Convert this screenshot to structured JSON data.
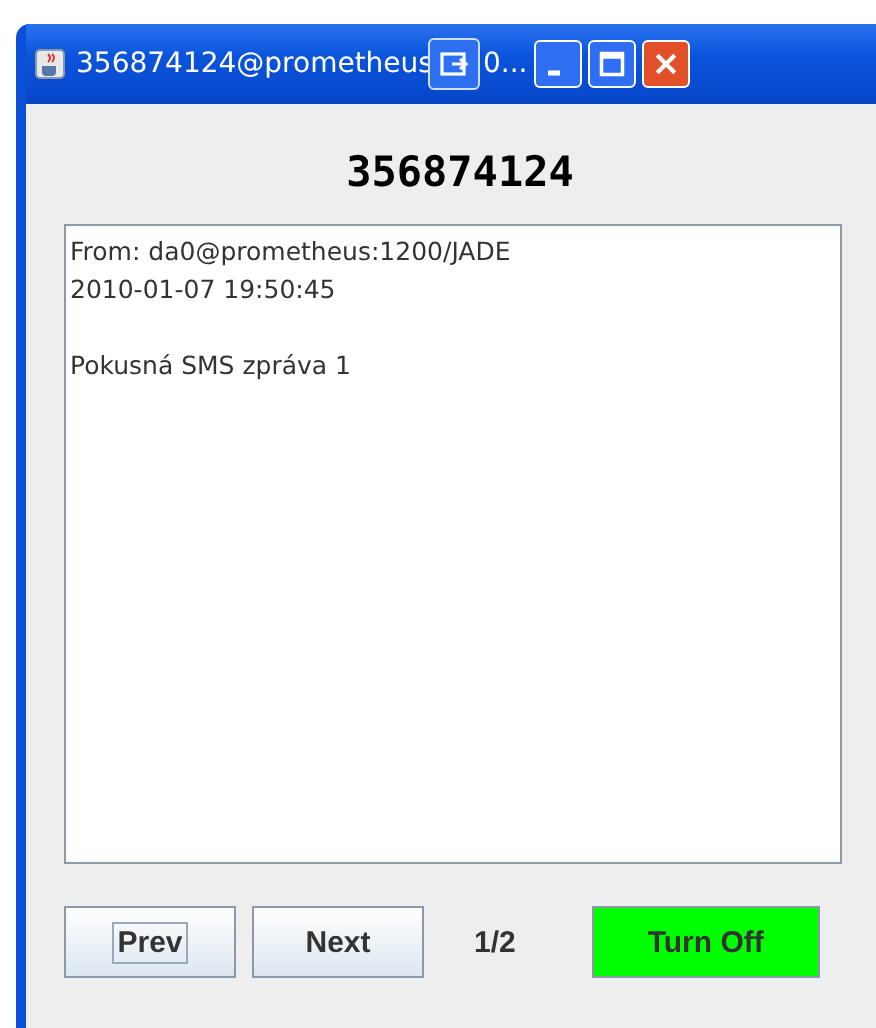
{
  "window": {
    "title_start": "356874124@prometheus",
    "title_end": "0..."
  },
  "heading": "356874124",
  "message": {
    "paragraphs": [
      [
        "From: da0@prometheus:1200/JADE",
        "2010-01-07 19:50:45"
      ],
      [
        "Pokusná SMS zpráva 1"
      ]
    ]
  },
  "buttons": [
    {
      "label": "Prev",
      "focused": true
    },
    {
      "label": "Next",
      "focused": false
    }
  ],
  "page_counter": "1/2",
  "power_button": {
    "label": "Turn Off",
    "on": true
  }
}
